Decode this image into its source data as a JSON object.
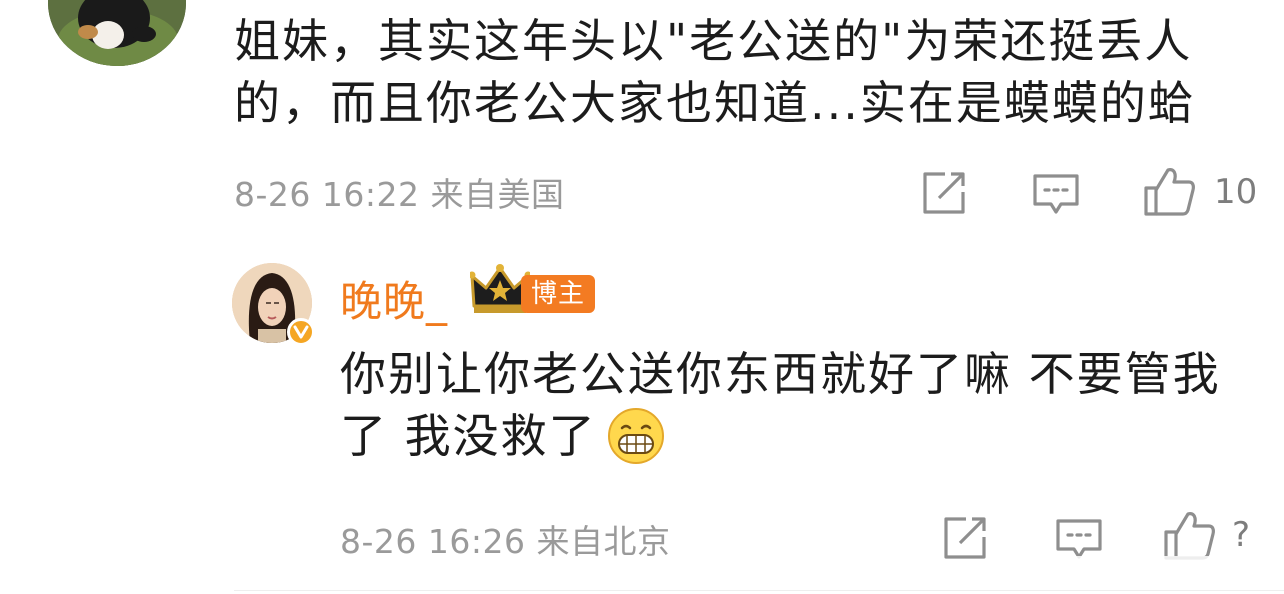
{
  "comment1": {
    "text_line1": "姐妹，其实这年头以\"老公送的\"为荣还挺丢人",
    "text_line2": "的，而且你老公大家也知道...实在是蟆蟆的蛤",
    "meta": "8-26 16:22 来自美国",
    "like_count": "10",
    "icons": [
      "share-icon",
      "comment-icon",
      "like-icon"
    ]
  },
  "reply": {
    "username": "晚晚_",
    "tag": "博主",
    "text_line1": "你别让你老公送你东西就好了嘛 不要管我",
    "text_line2": "了 我没救了",
    "meta": "8-26 16:26 来自北京",
    "like_count": "?",
    "icons": [
      "share-icon",
      "comment-icon",
      "like-icon",
      "grin-emoji"
    ]
  },
  "colors": {
    "username": "#f07a1d",
    "tag_bg": "#f37b22",
    "meta": "#9a9a9a",
    "verified": "#f5a623"
  }
}
